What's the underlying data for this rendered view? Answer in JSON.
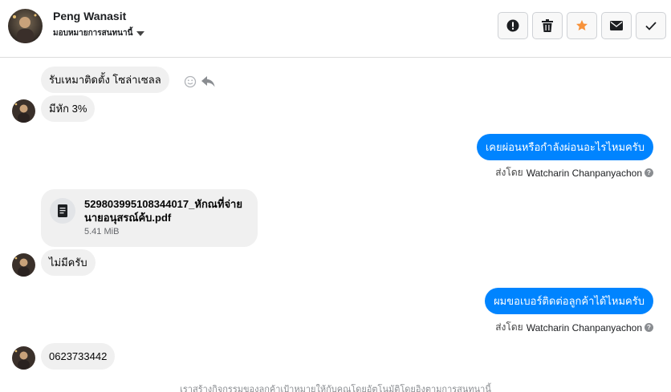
{
  "header": {
    "contact_name": "Peng Wanasit",
    "assign_label": "มอบหมายการสนทนานี้",
    "actions": [
      {
        "name": "mark-spam",
        "icon": "exclamation-icon"
      },
      {
        "name": "delete",
        "icon": "trash-icon"
      },
      {
        "name": "star",
        "icon": "star-icon"
      },
      {
        "name": "mark-unread",
        "icon": "envelope-icon"
      },
      {
        "name": "done",
        "icon": "check-icon"
      }
    ],
    "star_color": "#f7923a"
  },
  "messages": [
    {
      "direction": "in",
      "text": "รับเหมาติดตั้ง โซล่าเซลล"
    },
    {
      "direction": "in",
      "text": "มีหัก 3%"
    },
    {
      "direction": "out",
      "text": "เคยผ่อนหรือกำลังผ่อนอะไรไหมครับ",
      "sent_by_label": "ส่งโดย",
      "agent": "Watcharin Chanpanyachon"
    },
    {
      "direction": "in",
      "type": "file",
      "file_name": "529803995108344017_หักณที่จ่าย นายอนุสรณ์ค้บ.pdf",
      "file_size": "5.41 MiB"
    },
    {
      "direction": "in",
      "text": "ไม่มีครับ"
    },
    {
      "direction": "out",
      "text": "ผมขอเบอร์ติดต่อลูกค้าได้ไหมครับ",
      "sent_by_label": "ส่งโดย",
      "agent": "Watcharin Chanpanyachon"
    },
    {
      "direction": "in",
      "text": "0623733442"
    }
  ],
  "footer_note": "เราสร้างกิจกรรมของลูกค้าเป้าหมายให้กับคุณโดยอัตโนมัติโดยอิงตามการสนทนานี้",
  "colors": {
    "accent": "#0084ff",
    "incoming_bubble": "#f0f0f0"
  }
}
